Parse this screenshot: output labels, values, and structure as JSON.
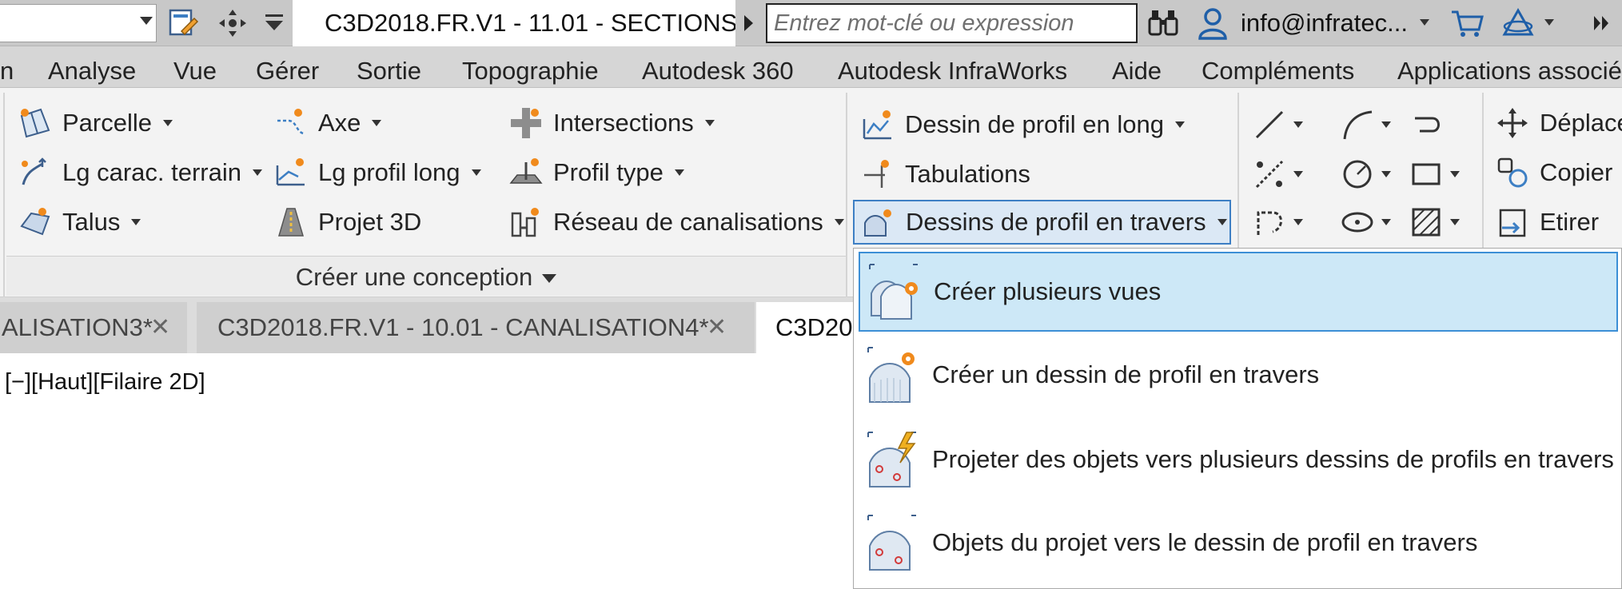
{
  "titlebar": {
    "document_title": "C3D2018.FR.V1 - 11.01 - SECTIONS...",
    "search_placeholder": "Entrez mot-clé ou expression",
    "user": "info@infratec...",
    "icons": [
      "workspace-icon",
      "pan-icon",
      "customize-icon",
      "binoculars-icon",
      "user-icon",
      "cart-icon",
      "a360-icon",
      "overflow-icon"
    ]
  },
  "menu": {
    "items": [
      "n",
      "Analyse",
      "Vue",
      "Gérer",
      "Sortie",
      "Topographie",
      "Autodesk 360",
      "Autodesk InfraWorks",
      "Aide",
      "Compléments",
      "Applications associée"
    ]
  },
  "ribbon": {
    "col1": [
      "Parcelle",
      "Lg carac. terrain",
      "Talus"
    ],
    "col2": [
      "Axe",
      "Lg profil long",
      "Projet 3D"
    ],
    "col3": [
      "Intersections",
      "Profil type",
      "Réseau de canalisations"
    ],
    "col4": [
      "Dessin de profil en long",
      "Tabulations",
      "Dessins de profil en travers"
    ],
    "modify": [
      "Déplace",
      "Copier",
      "Etirer"
    ],
    "panel_title": "Créer une conception"
  },
  "tabs": [
    "ALISATION3*",
    "C3D2018.FR.V1 - 10.01 - CANALISATION4*",
    "C3D20"
  ],
  "viewport": {
    "label": "[−][Haut][Filaire 2D]"
  },
  "dropdown": {
    "items": [
      "Créer plusieurs vues",
      "Créer un dessin de profil en travers",
      "Projeter des objets vers plusieurs dessins de profils en travers",
      "Objets du projet vers le dessin de profil en travers"
    ]
  },
  "colors": {
    "accent_orange": "#f08a1c",
    "accent_blue": "#3d7fc4",
    "highlight_bg": "#cde8f7"
  }
}
